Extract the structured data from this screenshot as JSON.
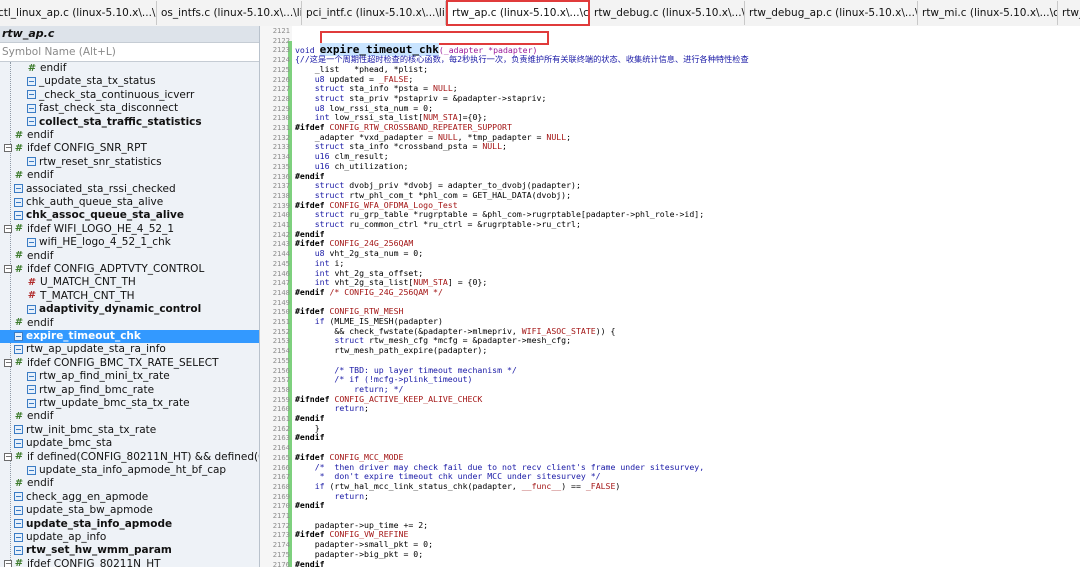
{
  "tabs": [
    {
      "label": "ctl_linux_ap.c (linux-5.10.x\\...\\linux)",
      "active": false
    },
    {
      "label": "os_intfs.c (linux-5.10.x\\...\\linux)",
      "active": false
    },
    {
      "label": "pci_intf.c (linux-5.10.x\\...\\linux)",
      "active": false
    },
    {
      "label": "rtw_ap.c (linux-5.10.x\\...\\core)",
      "active": true
    },
    {
      "label": "rtw_debug.c (linux-5.10.x\\...\\core)",
      "active": false
    },
    {
      "label": "rtw_debug_ap.c (linux-5.10.x\\...\\core)",
      "active": false
    },
    {
      "label": "rtw_mi.c (linux-5.10.x\\...\\core)",
      "active": false
    },
    {
      "label": "rtw_",
      "active": false
    }
  ],
  "tab_close_glyph": "×",
  "left_panel": {
    "title": "rtw_ap.c",
    "search_placeholder": "Symbol Name (Alt+L)",
    "items": [
      {
        "label": "endif",
        "icon": "ifdef",
        "indent": 2,
        "bold": false
      },
      {
        "label": "_update_sta_tx_status",
        "icon": "func",
        "indent": 2,
        "bold": false
      },
      {
        "label": "_check_sta_continuous_icverr",
        "icon": "func",
        "indent": 2,
        "bold": false
      },
      {
        "label": "fast_check_sta_disconnect",
        "icon": "func",
        "indent": 2,
        "bold": false
      },
      {
        "label": "collect_sta_traffic_statistics",
        "icon": "func",
        "indent": 2,
        "bold": true
      },
      {
        "label": "endif",
        "icon": "ifdef",
        "indent": 1,
        "bold": false
      },
      {
        "label": "ifdef CONFIG_SNR_RPT",
        "icon": "ifdef",
        "indent": 0,
        "bold": false,
        "expander": "-"
      },
      {
        "label": "rtw_reset_snr_statistics",
        "icon": "func",
        "indent": 2,
        "bold": false
      },
      {
        "label": "endif",
        "icon": "ifdef",
        "indent": 1,
        "bold": false
      },
      {
        "label": "associated_sta_rssi_checked",
        "icon": "func",
        "indent": 1,
        "bold": false
      },
      {
        "label": "chk_auth_queue_sta_alive",
        "icon": "func",
        "indent": 1,
        "bold": false
      },
      {
        "label": "chk_assoc_queue_sta_alive",
        "icon": "func",
        "indent": 1,
        "bold": true
      },
      {
        "label": "ifdef WIFI_LOGO_HE_4_52_1",
        "icon": "ifdef",
        "indent": 0,
        "bold": false,
        "expander": "-"
      },
      {
        "label": "wifi_HE_logo_4_52_1_chk",
        "icon": "func",
        "indent": 2,
        "bold": false
      },
      {
        "label": "endif",
        "icon": "ifdef",
        "indent": 1,
        "bold": false
      },
      {
        "label": "ifdef CONFIG_ADPTVTY_CONTROL",
        "icon": "ifdef",
        "indent": 0,
        "bold": false,
        "expander": "-"
      },
      {
        "label": "U_MATCH_CNT_TH",
        "icon": "macro",
        "indent": 2,
        "bold": false
      },
      {
        "label": "T_MATCH_CNT_TH",
        "icon": "macro",
        "indent": 2,
        "bold": false
      },
      {
        "label": "adaptivity_dynamic_control",
        "icon": "func",
        "indent": 2,
        "bold": true
      },
      {
        "label": "endif",
        "icon": "ifdef",
        "indent": 1,
        "bold": false
      },
      {
        "label": "expire_timeout_chk",
        "icon": "func",
        "indent": 1,
        "bold": true,
        "selected": true
      },
      {
        "label": "rtw_ap_update_sta_ra_info",
        "icon": "func",
        "indent": 1,
        "bold": false
      },
      {
        "label": "ifdef CONFIG_BMC_TX_RATE_SELECT",
        "icon": "ifdef",
        "indent": 0,
        "bold": false,
        "expander": "-"
      },
      {
        "label": "rtw_ap_find_mini_tx_rate",
        "icon": "func",
        "indent": 2,
        "bold": false
      },
      {
        "label": "rtw_ap_find_bmc_rate",
        "icon": "func",
        "indent": 2,
        "bold": false
      },
      {
        "label": "rtw_update_bmc_sta_tx_rate",
        "icon": "func",
        "indent": 2,
        "bold": false
      },
      {
        "label": "endif",
        "icon": "ifdef",
        "indent": 1,
        "bold": false
      },
      {
        "label": "rtw_init_bmc_sta_tx_rate",
        "icon": "func",
        "indent": 1,
        "bold": false
      },
      {
        "label": "update_bmc_sta",
        "icon": "func",
        "indent": 1,
        "bold": false
      },
      {
        "label": "if defined(CONFIG_80211N_HT) && defined(C",
        "icon": "ifdef",
        "indent": 0,
        "bold": false,
        "expander": "-"
      },
      {
        "label": "update_sta_info_apmode_ht_bf_cap",
        "icon": "func",
        "indent": 2,
        "bold": false
      },
      {
        "label": "endif",
        "icon": "ifdef",
        "indent": 1,
        "bold": false
      },
      {
        "label": "check_agg_en_apmode",
        "icon": "func",
        "indent": 1,
        "bold": false
      },
      {
        "label": "update_sta_bw_apmode",
        "icon": "func",
        "indent": 1,
        "bold": false
      },
      {
        "label": "update_sta_info_apmode",
        "icon": "func",
        "indent": 1,
        "bold": true
      },
      {
        "label": "update_ap_info",
        "icon": "func",
        "indent": 1,
        "bold": false
      },
      {
        "label": "rtw_set_hw_wmm_param",
        "icon": "func",
        "indent": 1,
        "bold": true
      },
      {
        "label": "ifdef CONFIG_80211N_HT",
        "icon": "ifdef",
        "indent": 0,
        "bold": false,
        "expander": "-"
      }
    ]
  },
  "editor": {
    "lines": [
      {
        "n": "2121",
        "t": ""
      },
      {
        "n": "2122",
        "t": ""
      },
      {
        "n": "2123",
        "t": "void ",
        "fn": "expire_timeout_chk",
        "rest": "(_adapter *padapter)"
      },
      {
        "n": "2124",
        "t": "{//这是一个周期性超时检查的核心函数，每2秒执行一次，负责维护所有关联终端的状态、收集统计信息、进行各种特性检查",
        "cls": "c"
      },
      {
        "n": "2125",
        "t": "    _list   *phead, *plist;"
      },
      {
        "n": "2126",
        "t": "    u8 updated = _FALSE;"
      },
      {
        "n": "2127",
        "t": "    struct sta_info *psta = NULL;"
      },
      {
        "n": "2128",
        "t": "    struct sta_priv *pstapriv = &padapter->stapriv;"
      },
      {
        "n": "2129",
        "t": "    u8 low_rssi_sta_num = 0;"
      },
      {
        "n": "2130",
        "t": "    int low_rssi_sta_list[NUM_STA]={0};"
      },
      {
        "n": "2131",
        "t": "#ifdef CONFIG_RTW_CROSSBAND_REPEATER_SUPPORT",
        "cls": "pp"
      },
      {
        "n": "2132",
        "t": "    _adapter *vxd_padapter = NULL, *tmp_padapter = NULL;"
      },
      {
        "n": "2133",
        "t": "    struct sta_info *crossband_psta = NULL;"
      },
      {
        "n": "2134",
        "t": "    u16 clm_result;"
      },
      {
        "n": "2135",
        "t": "    u16 ch_utilization;"
      },
      {
        "n": "2136",
        "t": "#endif",
        "cls": "pp"
      },
      {
        "n": "2137",
        "t": "    struct dvobj_priv *dvobj = adapter_to_dvobj(padapter);"
      },
      {
        "n": "2138",
        "t": "    struct rtw_phl_com_t *phl_com = GET_HAL_DATA(dvobj);"
      },
      {
        "n": "2139",
        "t": "#ifdef CONFIG_WFA_OFDMA_Logo_Test",
        "cls": "pp"
      },
      {
        "n": "2140",
        "t": "    struct ru_grp_table *rugrptable = &phl_com->rugrptable[padapter->phl_role->id];"
      },
      {
        "n": "2141",
        "t": "    struct ru_common_ctrl *ru_ctrl = &rugrptable->ru_ctrl;"
      },
      {
        "n": "2142",
        "t": "#endif",
        "cls": "pp"
      },
      {
        "n": "2143",
        "t": "#ifdef CONFIG_24G_256QAM",
        "cls": "pp"
      },
      {
        "n": "2144",
        "t": "    u8 vht_2g_sta_num = 0;"
      },
      {
        "n": "2145",
        "t": "    int i;"
      },
      {
        "n": "2146",
        "t": "    int vht_2g_sta_offset;"
      },
      {
        "n": "2147",
        "t": "    int vht_2g_sta_list[NUM_STA] = {0};"
      },
      {
        "n": "2148",
        "t": "#endif /* CONFIG_24G_256QAM */",
        "cls": "pp"
      },
      {
        "n": "2149",
        "t": ""
      },
      {
        "n": "2150",
        "t": "#ifdef CONFIG_RTW_MESH",
        "cls": "pp"
      },
      {
        "n": "2151",
        "t": "    if (MLME_IS_MESH(padapter)"
      },
      {
        "n": "2152",
        "t": "        && check_fwstate(&padapter->mlmepriv, WIFI_ASOC_STATE)) {"
      },
      {
        "n": "2153",
        "t": "        struct rtw_mesh_cfg *mcfg = &padapter->mesh_cfg;"
      },
      {
        "n": "2154",
        "t": "        rtw_mesh_path_expire(padapter);"
      },
      {
        "n": "2155",
        "t": ""
      },
      {
        "n": "2156",
        "t": "        /* TBD: up layer timeout mechanism */",
        "cls": "c"
      },
      {
        "n": "2157",
        "t": "        /* if (!mcfg->plink_timeout)",
        "cls": "c"
      },
      {
        "n": "2158",
        "t": "            return; */",
        "cls": "c"
      },
      {
        "n": "2159",
        "t": "#ifndef CONFIG_ACTIVE_KEEP_ALIVE_CHECK",
        "cls": "pp"
      },
      {
        "n": "2160",
        "t": "        return;"
      },
      {
        "n": "2161",
        "t": "#endif",
        "cls": "pp"
      },
      {
        "n": "2162",
        "t": "    }"
      },
      {
        "n": "2163",
        "t": "#endif",
        "cls": "pp"
      },
      {
        "n": "2164",
        "t": ""
      },
      {
        "n": "2165",
        "t": "#ifdef CONFIG_MCC_MODE",
        "cls": "pp"
      },
      {
        "n": "2166",
        "t": "    /*  then driver may check fail due to not recv client's frame under sitesurvey,",
        "cls": "c"
      },
      {
        "n": "2167",
        "t": "     *  don't expire timeout chk under MCC under sitesurvey */",
        "cls": "c"
      },
      {
        "n": "2168",
        "t": "    if (rtw_hal_mcc_link_status_chk(padapter, __func__) == _FALSE)"
      },
      {
        "n": "2169",
        "t": "        return;"
      },
      {
        "n": "2170",
        "t": "#endif",
        "cls": "pp"
      },
      {
        "n": "2171",
        "t": ""
      },
      {
        "n": "2172",
        "t": "    padapter->up_time += 2;"
      },
      {
        "n": "2173",
        "t": "#ifdef CONFIG_VW_REFINE",
        "cls": "pp"
      },
      {
        "n": "2174",
        "t": "    padapter->small_pkt = 0;"
      },
      {
        "n": "2175",
        "t": "    padapter->big_pkt = 0;"
      },
      {
        "n": "2176",
        "t": "#endif",
        "cls": "pp"
      }
    ]
  }
}
